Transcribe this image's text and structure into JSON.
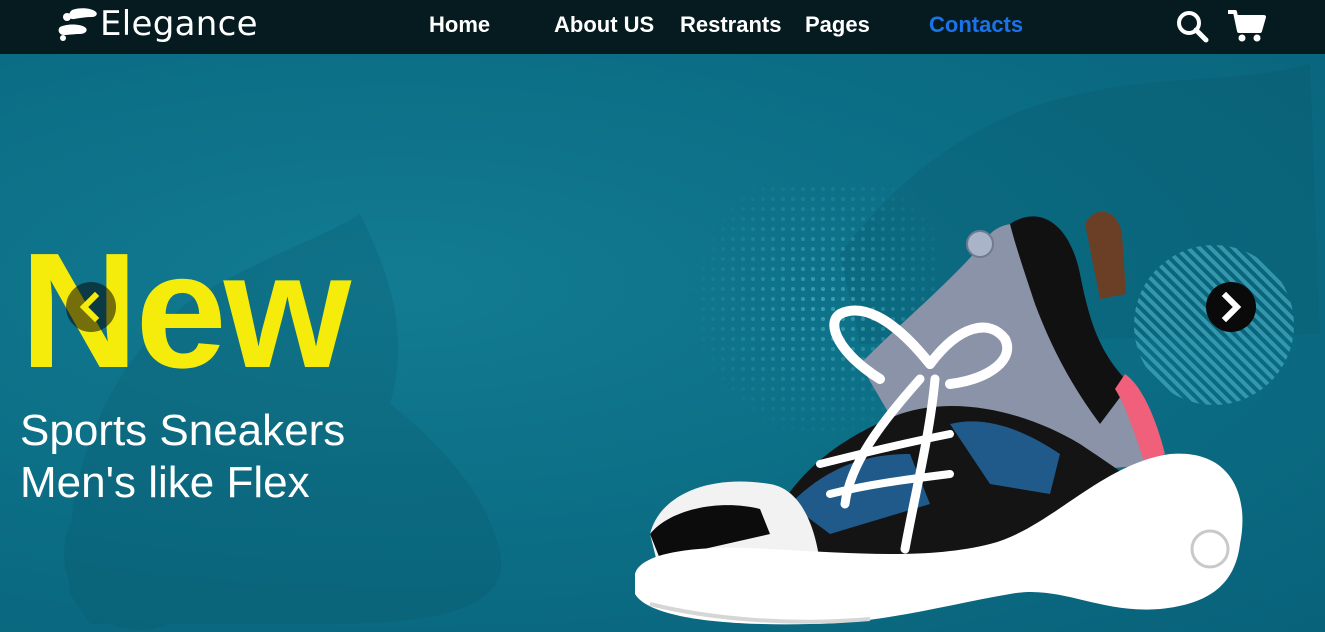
{
  "brand": {
    "name": "Elegance",
    "logo_icon": "shoe-prints-icon"
  },
  "nav": {
    "items": [
      {
        "label": "Home",
        "active": false
      },
      {
        "label": "About US",
        "active": false
      },
      {
        "label": "Restrants",
        "active": false
      },
      {
        "label": "Pages",
        "active": false
      },
      {
        "label": "Contacts",
        "active": true
      }
    ],
    "search_icon": "search-icon",
    "cart_icon": "cart-icon"
  },
  "hero": {
    "title": "New",
    "subtitle_line1": "Sports Sneakers",
    "subtitle_line2": "Men's like Flex",
    "prev_icon": "chevron-left-icon",
    "next_icon": "chevron-right-icon"
  },
  "colors": {
    "navbar_bg": "#061b20",
    "hero_bg": "#0c6f86",
    "title_yellow": "#f6ec0c",
    "active_link": "#1a73e8",
    "text_white": "#ffffff"
  }
}
